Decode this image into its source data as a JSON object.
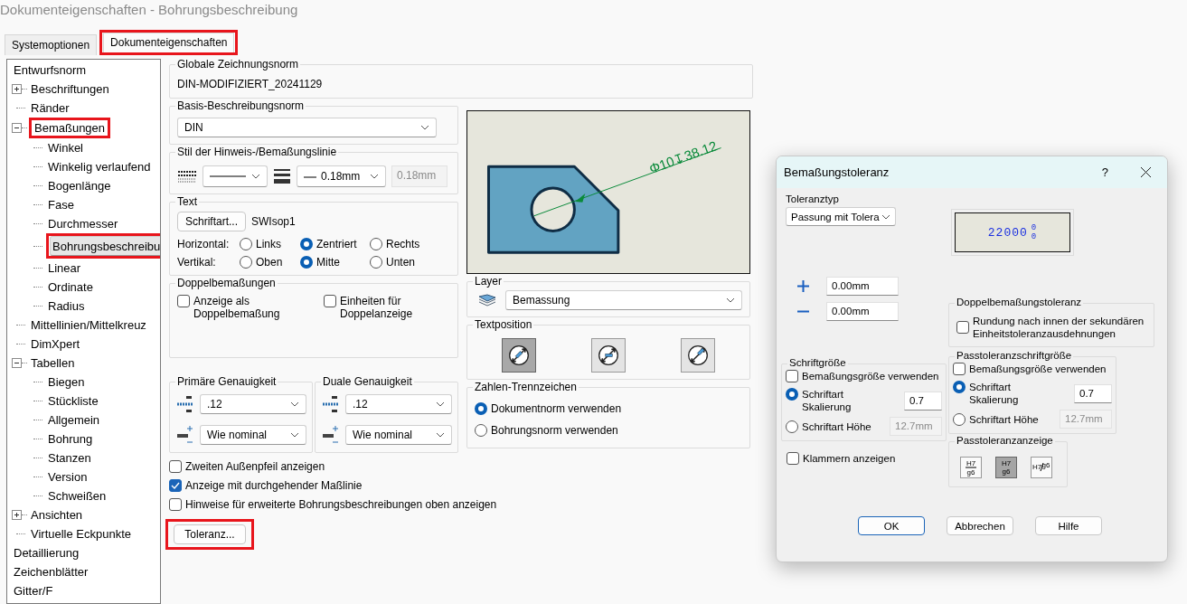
{
  "window": {
    "title": "Dokumenteigenschaften - Bohrungsbeschreibung"
  },
  "tabs": [
    {
      "label": "Systemoptionen",
      "selected": false,
      "highlighted": false
    },
    {
      "label": "Dokumenteigenschaften",
      "selected": true,
      "highlighted": true
    }
  ],
  "tree": [
    {
      "label": "Entwurfsnorm",
      "selected": false,
      "highlighted": false,
      "children": [
        {
          "label": "Beschriftungen",
          "selected": false,
          "highlighted": false,
          "expanded": false
        },
        {
          "label": "Ränder",
          "selected": false,
          "highlighted": false
        },
        {
          "label": "Bemaßungen",
          "selected": false,
          "highlighted": true,
          "expanded": true,
          "children": [
            {
              "label": "Winkel",
              "selected": false,
              "highlighted": false
            },
            {
              "label": "Winkelig verlaufend",
              "selected": false,
              "highlighted": false
            },
            {
              "label": "Bogenlänge",
              "selected": false,
              "highlighted": false
            },
            {
              "label": "Fase",
              "selected": false,
              "highlighted": false
            },
            {
              "label": "Durchmesser",
              "selected": false,
              "highlighted": false
            },
            {
              "label": "Bohrungsbeschreibu",
              "selected": true,
              "highlighted": true
            },
            {
              "label": "Linear",
              "selected": false,
              "highlighted": false
            },
            {
              "label": "Ordinate",
              "selected": false,
              "highlighted": false
            },
            {
              "label": "Radius",
              "selected": false,
              "highlighted": false
            }
          ]
        },
        {
          "label": "Mittellinien/Mittelkreuz",
          "selected": false,
          "highlighted": false
        },
        {
          "label": "DimXpert",
          "selected": false,
          "highlighted": false
        },
        {
          "label": "Tabellen",
          "selected": false,
          "highlighted": false,
          "expanded": true,
          "children": [
            {
              "label": "Biegen",
              "selected": false,
              "highlighted": false
            },
            {
              "label": "Stückliste",
              "selected": false,
              "highlighted": false
            },
            {
              "label": "Allgemein",
              "selected": false,
              "highlighted": false
            },
            {
              "label": "Bohrung",
              "selected": false,
              "highlighted": false
            },
            {
              "label": "Stanzen",
              "selected": false,
              "highlighted": false
            },
            {
              "label": "Version",
              "selected": false,
              "highlighted": false
            },
            {
              "label": "Schweißen",
              "selected": false,
              "highlighted": false
            }
          ]
        },
        {
          "label": "Ansichten",
          "selected": false,
          "highlighted": false,
          "expanded": false
        },
        {
          "label": "Virtuelle Eckpunkte",
          "selected": false,
          "highlighted": false
        }
      ]
    },
    {
      "label": "Detaillierung",
      "selected": false,
      "highlighted": false
    },
    {
      "label": "Zeichenblätter",
      "selected": false,
      "highlighted": false
    },
    {
      "label": "Gitter/F",
      "selected": false,
      "highlighted": false
    }
  ],
  "global_standard": {
    "label": "Globale Zeichnungsnorm",
    "value": "DIN-MODIFIZIERT_20241129"
  },
  "base_standard": {
    "label": "Basis-Beschreibungsnorm",
    "value": "DIN"
  },
  "line_style": {
    "label": "Stil der Hinweis-/Bemaßungslinie",
    "thickness": "0.18mm",
    "thickness_field": "0.18mm"
  },
  "text": {
    "label": "Text",
    "font_button": "Schriftart...",
    "font_name": "SWIsop1",
    "rows": [
      {
        "label": "Horizontal:",
        "options": [
          {
            "label": "Links",
            "selected": false
          },
          {
            "label": "Zentriert",
            "selected": true
          },
          {
            "label": "Rechts",
            "selected": false
          }
        ]
      },
      {
        "label": "Vertikal:",
        "options": [
          {
            "label": "Oben",
            "selected": false
          },
          {
            "label": "Mitte",
            "selected": true
          },
          {
            "label": "Unten",
            "selected": false
          }
        ]
      }
    ]
  },
  "dual_dimensions": {
    "label": "Doppelbemaßungen",
    "checks": [
      {
        "label": "Anzeige als Doppelbemaßung",
        "checked": false
      },
      {
        "label": "Einheiten für Doppelanzeige",
        "checked": false
      }
    ]
  },
  "precision": [
    {
      "label": "Primäre Genauigkeit",
      "value": ".12",
      "tolerance": "Wie nominal"
    },
    {
      "label": "Duale Genauigkeit",
      "value": ".12",
      "tolerance": "Wie nominal"
    }
  ],
  "options": [
    {
      "label": "Zweiten Außenpfeil anzeigen",
      "checked": false
    },
    {
      "label": "Anzeige mit durchgehender Maßlinie",
      "checked": true
    },
    {
      "label": "Hinweise für erweiterte Bohrungsbeschreibungen oben anzeigen",
      "checked": false
    }
  ],
  "tolerance_button": {
    "label": "Toleranz...",
    "highlighted": true
  },
  "preview": {
    "callout": "Φ10↧38.12"
  },
  "layer": {
    "label": "Layer",
    "value": "Bemassung"
  },
  "text_position": {
    "label": "Textposition",
    "options": [
      {
        "kind": "inline",
        "selected": true
      },
      {
        "kind": "horizontal",
        "selected": false
      },
      {
        "kind": "offset",
        "selected": false
      }
    ]
  },
  "separator": {
    "label": "Zahlen-Trennzeichen",
    "options": [
      {
        "label": "Dokumentnorm verwenden",
        "selected": true
      },
      {
        "label": "Bohrungsnorm verwenden",
        "selected": false
      }
    ]
  },
  "dialog": {
    "title": "Bemaßungstoleranz",
    "help": "?",
    "tolerance_type": {
      "label": "Toleranztyp",
      "value": "Passung mit Tolera"
    },
    "preview": {
      "value": "22000",
      "upper": "0",
      "lower": "0"
    },
    "plus": "0.00mm",
    "minus": "0.00mm",
    "dual_tolerance": {
      "label": "Doppelbemaßungstoleranz",
      "check": {
        "label": "Rundung nach innen der sekundären Einheitstoleranzausdehnungen",
        "checked": false
      }
    },
    "font_size": {
      "label": "Schriftgröße",
      "use_dim": {
        "label": "Bemaßungsgröße verwenden",
        "checked": false
      },
      "options": [
        {
          "label": "Schriftart Skalierung",
          "selected": true,
          "value": "0.7"
        },
        {
          "label": "Schriftart Höhe",
          "selected": false,
          "value": "12.7mm"
        }
      ]
    },
    "fit_font_size": {
      "label": "Passtoleranzschriftgröße",
      "use_dim": {
        "label": "Bemaßungsgröße verwenden",
        "checked": false
      },
      "options": [
        {
          "label": "Schriftart Skalierung",
          "selected": true,
          "value": "0.7"
        },
        {
          "label": "Schriftart Höhe",
          "selected": false,
          "value": "12.7mm"
        }
      ]
    },
    "brackets": {
      "label": "Klammern anzeigen",
      "checked": false
    },
    "fit_display": {
      "label": "Passtoleranzanzeige",
      "options": [
        {
          "kind": "stacked-line",
          "upper": "H7",
          "lower": "g6",
          "selected": false
        },
        {
          "kind": "stacked",
          "upper": "H7",
          "lower": "g6",
          "selected": true
        },
        {
          "kind": "linear",
          "upper": "H7",
          "lower": "g6",
          "selected": false
        }
      ]
    },
    "buttons": [
      {
        "label": "OK",
        "default": true
      },
      {
        "label": "Abbrechen",
        "default": false
      },
      {
        "label": "Hilfe",
        "default": false
      }
    ]
  }
}
